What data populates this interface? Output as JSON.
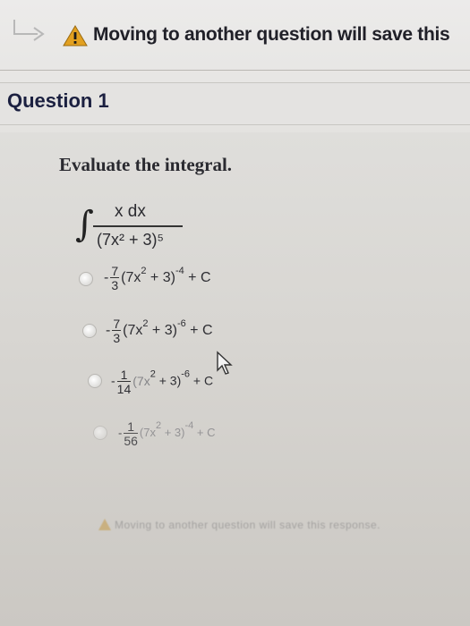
{
  "banner": {
    "icon": "warning-icon",
    "message": "Moving to another question will save this"
  },
  "question": {
    "title": "Question 1",
    "prompt": "Evaluate the integral.",
    "integrand_numerator": "x dx",
    "integrand_denominator": "(7x² + 3)⁵"
  },
  "options": [
    {
      "sign": "-",
      "frac_num": "7",
      "frac_den": "3",
      "body": "(7x",
      "exp_inner": "2",
      "mid": " + 3)",
      "exp_outer": "-4",
      "tail": " + C"
    },
    {
      "sign": "-",
      "frac_num": "7",
      "frac_den": "3",
      "body": "(7x",
      "exp_inner": "2",
      "mid": " + 3)",
      "exp_outer": "-6",
      "tail": " + C"
    },
    {
      "sign": "-",
      "frac_num": "1",
      "frac_den": "14",
      "body": "(7x",
      "exp_inner": "2",
      "mid": " + 3)",
      "exp_outer": "-6",
      "tail": " + C"
    },
    {
      "sign": "-",
      "frac_num": "1",
      "frac_den": "56",
      "body": "(7x",
      "exp_inner": "2",
      "mid": " + 3)",
      "exp_outer": "-4",
      "tail": " + C"
    }
  ],
  "footer": {
    "message": "Moving to another question will save this response."
  },
  "colors": {
    "warning": "#e2a020",
    "text": "#202028"
  }
}
